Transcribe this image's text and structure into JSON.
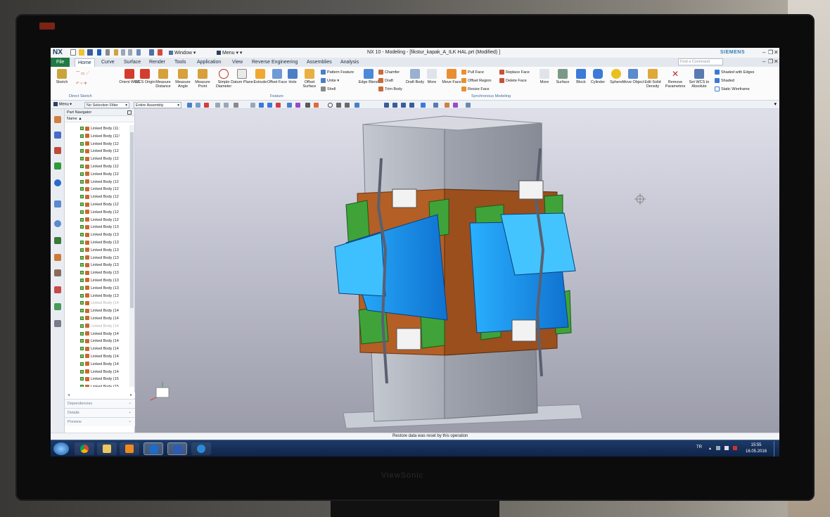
{
  "app": {
    "logo": "NX",
    "title": "NX 10 - Modeling - [fikstur_kapak_A_ILK HAL.prt (Modified) ]",
    "brand": "SIEMENS",
    "window_menu": "Window",
    "menu_menu": "Menu"
  },
  "monitor_brand": "ViewSonic",
  "tabs": [
    "File",
    "Home",
    "Curve",
    "Surface",
    "Render",
    "Tools",
    "Application",
    "View",
    "Reverse Engineering",
    "Assemblies",
    "Analysis"
  ],
  "active_tab": "Home",
  "search": {
    "placeholder": "Find a Command"
  },
  "ribbon": {
    "sketch": "Sketch",
    "orient_wcs": "Orient WCS",
    "wcs_origin": "WCS Origin",
    "measure_distance": "Measure Distance",
    "measure_angle": "Measure Angle",
    "measure_point": "Measure Point",
    "simple_diameter": "Simple Diameter",
    "datum_plane": "Datum Plane",
    "extrude": "Extrude",
    "offset_face": "Offset Face",
    "hole": "Hole",
    "offset_surface": "Offset Surface",
    "pattern_feature": "Pattern Feature",
    "unite": "Unite",
    "shell": "Shell",
    "edge_blend": "Edge Blend",
    "chamfer": "Chamfer",
    "draft": "Draft",
    "trim_body": "Trim Body",
    "draft_body": "Draft Body",
    "more1": "More",
    "move_face": "Move Face",
    "pull_face": "Pull Face",
    "offset_region": "Offset Region",
    "resize_face": "Resize Face",
    "replace_face": "Replace Face",
    "delete_face": "Delete Face",
    "more2": "More",
    "surface": "Surface",
    "block": "Block",
    "cylinder": "Cylinder",
    "sphere": "Sphere",
    "move_object": "Move Object",
    "edit_solid_density": "Edit Solid Density",
    "remove_parameters": "Remove Parameters",
    "set_wcs_absolute": "Set WCS to Absolute",
    "shaded_with_edges": "Shaded with Edges",
    "shaded": "Shaded",
    "static_wireframe": "Static Wireframe",
    "group_direct_sketch": "Direct Sketch",
    "group_feature": "Feature",
    "group_synchronous": "Synchronous Modeling"
  },
  "toolbar2": {
    "menu": "Menu",
    "selection_filter": "No Selection Filter",
    "scope": "Entire Assembly"
  },
  "navigator": {
    "title": "Part Navigator",
    "column_name": "Name",
    "items": [
      {
        "label": "Linked Body (11:",
        "dim": false
      },
      {
        "label": "Linked Body (11!",
        "dim": false
      },
      {
        "label": "Linked Body (12",
        "dim": false
      },
      {
        "label": "Linked Body (12",
        "dim": false
      },
      {
        "label": "Linked Body (12",
        "dim": false
      },
      {
        "label": "Linked Body (12",
        "dim": false
      },
      {
        "label": "Linked Body (12",
        "dim": false
      },
      {
        "label": "Linked Body (12",
        "dim": false
      },
      {
        "label": "Linked Body (12",
        "dim": false
      },
      {
        "label": "Linked Body (12",
        "dim": false
      },
      {
        "label": "Linked Body (12",
        "dim": false
      },
      {
        "label": "Linked Body (12",
        "dim": false
      },
      {
        "label": "Linked Body (12",
        "dim": false
      },
      {
        "label": "Linked Body (13",
        "dim": false
      },
      {
        "label": "Linked Body (13",
        "dim": false
      },
      {
        "label": "Linked Body (13",
        "dim": false
      },
      {
        "label": "Linked Body (13",
        "dim": false
      },
      {
        "label": "Linked Body (13",
        "dim": false
      },
      {
        "label": "Linked Body (13",
        "dim": false
      },
      {
        "label": "Linked Body (13",
        "dim": false
      },
      {
        "label": "Linked Body (13",
        "dim": false
      },
      {
        "label": "Linked Body (13",
        "dim": false
      },
      {
        "label": "Linked Body (13",
        "dim": false
      },
      {
        "label": "Linked Body (14",
        "dim": true
      },
      {
        "label": "Linked Body (14",
        "dim": false
      },
      {
        "label": "Linked Body (14",
        "dim": false
      },
      {
        "label": "Linked Body (14",
        "dim": true
      },
      {
        "label": "Linked Body (14",
        "dim": false
      },
      {
        "label": "Linked Body (14",
        "dim": false
      },
      {
        "label": "Linked Body (14",
        "dim": false
      },
      {
        "label": "Linked Body (14",
        "dim": false
      },
      {
        "label": "Linked Body (14",
        "dim": false
      },
      {
        "label": "Linked Body (14",
        "dim": false
      },
      {
        "label": "Linked Body (15",
        "dim": false
      },
      {
        "label": "Linked Body (15",
        "dim": false
      },
      {
        "label": "Linked Body (15",
        "dim": true
      }
    ],
    "panels": [
      "Dependencies",
      "Details",
      "Preview"
    ]
  },
  "status": "Restore data was reset by this operation",
  "taskbar": {
    "language": "TR",
    "time": "15:55",
    "date": "16.05.2016"
  },
  "colors": {
    "nx_blue": "#1b3a63",
    "file_tab": "#1f7a45",
    "part_blue": "#1e9bf0",
    "plate_green": "#3fa33a",
    "plate_brown": "#b35f25",
    "steel_gray": "#b8bcc6",
    "taskbar": "#142e57"
  }
}
